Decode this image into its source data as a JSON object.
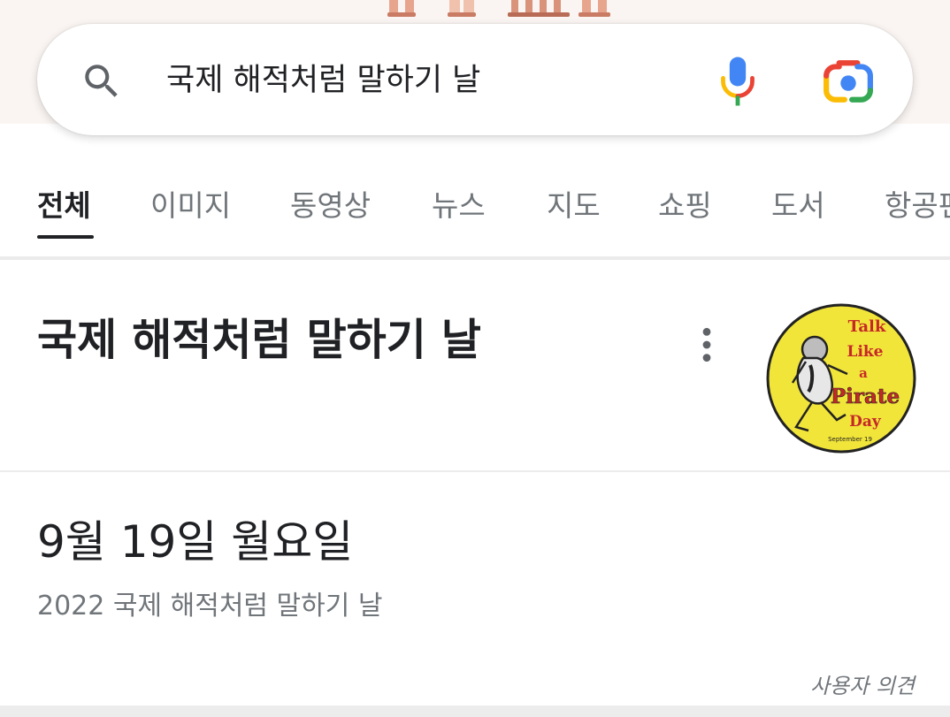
{
  "search": {
    "query": "국제 해적처럼 말하기 날"
  },
  "tabs": [
    {
      "label": "전체",
      "active": true
    },
    {
      "label": "이미지"
    },
    {
      "label": "동영상"
    },
    {
      "label": "뉴스"
    },
    {
      "label": "지도"
    },
    {
      "label": "쇼핑"
    },
    {
      "label": "도서"
    },
    {
      "label": "항공편"
    }
  ],
  "knowledge_panel": {
    "title": "국제 해적처럼 말하기 날",
    "image": {
      "line1": "Talk",
      "line2": "Like",
      "line3": "a",
      "line4": "Pirate",
      "line5": "Day",
      "caption": "September 19"
    }
  },
  "answer": {
    "date": "9월 19일 월요일",
    "subtitle": "2022 국제 해적처럼 말하기 날"
  },
  "feedback_label": "사용자 의견",
  "icons": {
    "search": "search-icon",
    "mic": "microphone-icon",
    "lens": "lens-camera-icon",
    "more": "more-vert-icon"
  },
  "colors": {
    "google_blue": "#4285F4",
    "google_red": "#EA4335",
    "google_yellow": "#FBBC05",
    "google_green": "#34A853",
    "text_primary": "#202124",
    "text_secondary": "#70757a"
  }
}
